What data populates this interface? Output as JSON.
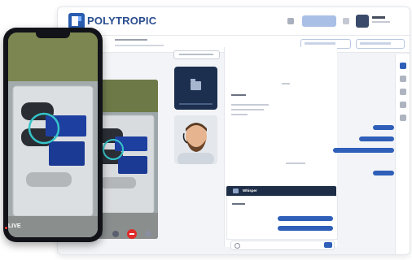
{
  "app": {
    "logo_text": "POLYTROPIC",
    "brand_color": "#2a5db0",
    "accent_color": "#2f5fb8",
    "end_call_color": "#e02a2a"
  },
  "phone": {
    "live_label": "LIVE"
  },
  "chat": {
    "bottom_header_label": "Whisper",
    "input_placeholder": ""
  },
  "icons": [
    "logo-icon",
    "bell-icon",
    "settings-icon",
    "folder-icon",
    "camera-icon",
    "mic-icon",
    "end-call-icon",
    "more-icon",
    "attach-icon",
    "send-icon",
    "chat-icon",
    "people-icon",
    "files-icon",
    "info-icon",
    "pin-icon"
  ]
}
